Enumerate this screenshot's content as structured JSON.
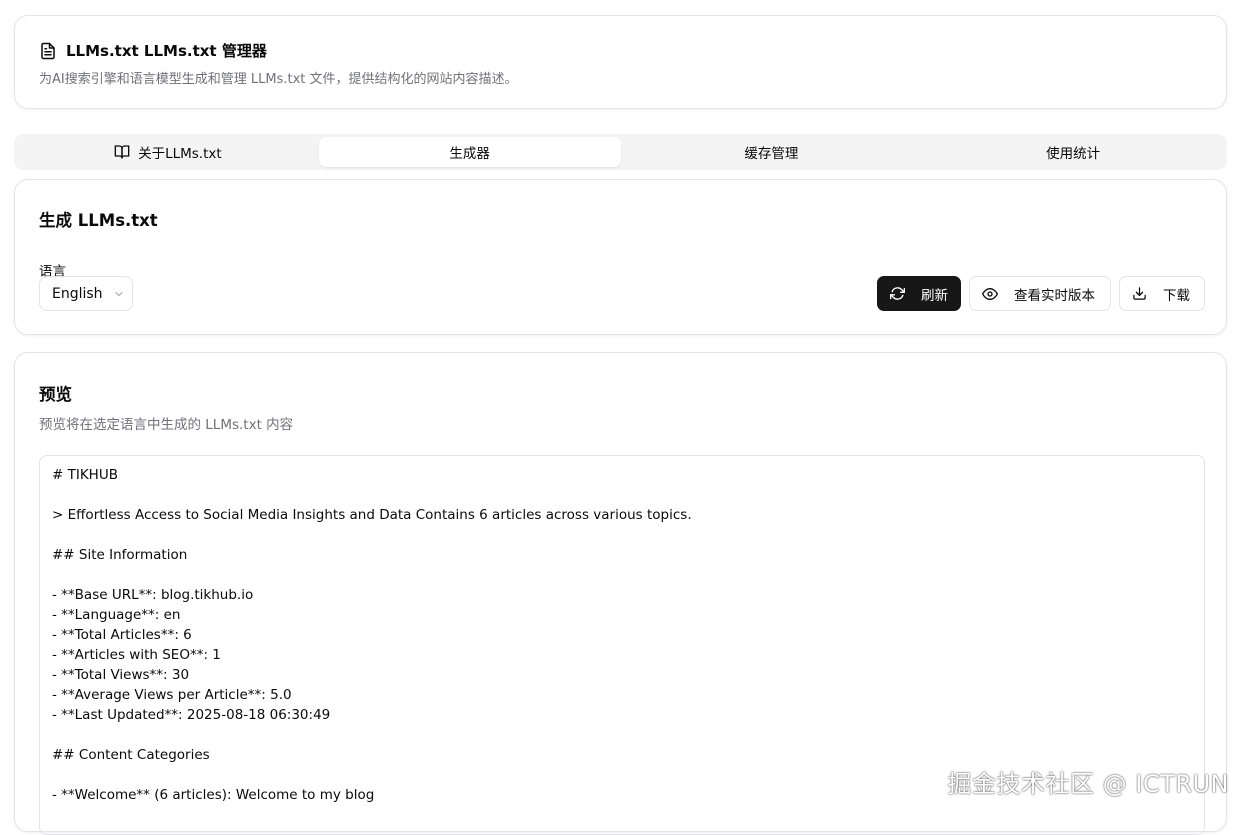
{
  "header": {
    "title": "LLMs.txt LLMs.txt 管理器",
    "description": "为AI搜索引擎和语言模型生成和管理 LLMs.txt 文件，提供结构化的网站内容描述。",
    "icon": "file-text-icon"
  },
  "tabs": [
    {
      "label": "关于LLMs.txt",
      "icon": "book-open-icon",
      "active": false
    },
    {
      "label": "生成器",
      "active": true
    },
    {
      "label": "缓存管理",
      "active": false
    },
    {
      "label": "使用统计",
      "active": false
    }
  ],
  "generator": {
    "title": "生成 LLMs.txt",
    "language_label": "语言",
    "language_value": "English",
    "buttons": {
      "refresh": "刷新",
      "view_live": "查看实时版本",
      "download": "下载"
    }
  },
  "preview": {
    "title": "预览",
    "description": "预览将在选定语言中生成的 LLMs.txt 内容",
    "lines": [
      "# TIKHUB",
      "",
      "> Effortless Access to Social Media Insights and Data Contains 6 articles across various topics.",
      "",
      "## Site Information",
      "",
      "- **Base URL**: blog.tikhub.io",
      "- **Language**: en",
      "- **Total Articles**: 6",
      "- **Articles with SEO**: 1",
      "- **Total Views**: 30",
      "- **Average Views per Article**: 5.0",
      "- **Last Updated**: 2025-08-18 06:30:49",
      "",
      "## Content Categories",
      "",
      "- **Welcome** (6 articles): Welcome to my blog"
    ]
  },
  "watermark": "掘金技术社区 @ ICTRUN",
  "colors": {
    "primary": "#171717",
    "border": "#e4e4e7",
    "muted_text": "#71717a",
    "tab_bg": "#f4f4f5"
  }
}
